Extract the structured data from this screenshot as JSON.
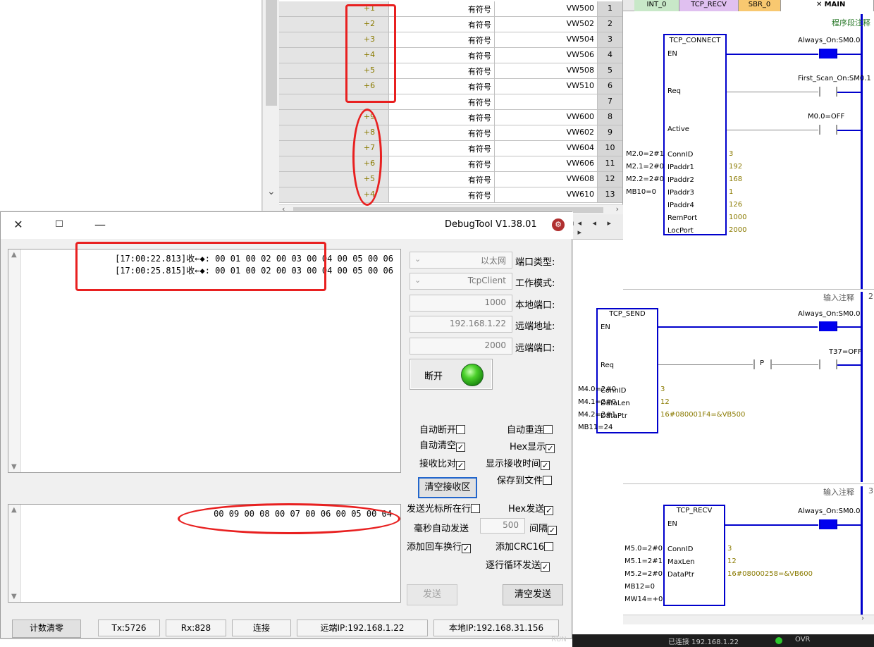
{
  "status_table": {
    "rows": [
      {
        "num": "1",
        "addr": "VW500",
        "fmt": "有符号",
        "value": "+1"
      },
      {
        "num": "2",
        "addr": "VW502",
        "fmt": "有符号",
        "value": "+2"
      },
      {
        "num": "3",
        "addr": "VW504",
        "fmt": "有符号",
        "value": "+3"
      },
      {
        "num": "4",
        "addr": "VW506",
        "fmt": "有符号",
        "value": "+4"
      },
      {
        "num": "5",
        "addr": "VW508",
        "fmt": "有符号",
        "value": "+5"
      },
      {
        "num": "6",
        "addr": "VW510",
        "fmt": "有符号",
        "value": "+6"
      },
      {
        "num": "7",
        "addr": "",
        "fmt": "有符号",
        "value": ""
      },
      {
        "num": "8",
        "addr": "VW600",
        "fmt": "有符号",
        "value": "+9"
      },
      {
        "num": "9",
        "addr": "VW602",
        "fmt": "有符号",
        "value": "+8"
      },
      {
        "num": "10",
        "addr": "VW604",
        "fmt": "有符号",
        "value": "+7"
      },
      {
        "num": "11",
        "addr": "VW606",
        "fmt": "有符号",
        "value": "+6"
      },
      {
        "num": "12",
        "addr": "VW608",
        "fmt": "有符号",
        "value": "+5"
      },
      {
        "num": "13",
        "addr": "VW610",
        "fmt": "有符号",
        "value": "+4"
      }
    ]
  },
  "ladder": {
    "tabs": [
      "MAIN",
      "SBR_0",
      "TCP_RECV",
      "INT_0"
    ],
    "network1": {
      "comment": "程序段注释",
      "block": "TCP_CONNECT",
      "pins": [
        "EN",
        "Req",
        "Active",
        "ConnID",
        "IPaddr1",
        "IPaddr2",
        "IPaddr3",
        "IPaddr4",
        "RemPort",
        "LocPort"
      ],
      "contacts": [
        "Always_On:SM0.0",
        "First_Scan_On:SM0.1",
        "M0.0=OFF"
      ],
      "outputs": [
        "M2.0=2#1",
        "M2.1=2#0",
        "M2.2=2#0",
        "MB10=0"
      ],
      "inputs": [
        "3",
        "192",
        "168",
        "1",
        "126",
        "1000",
        "2000"
      ]
    },
    "network2": {
      "num": "2",
      "comment": "输入注释",
      "block": "TCP_SEND",
      "pins": [
        "EN",
        "Req",
        "ConnID",
        "DataLen",
        "DataPtr"
      ],
      "contacts": [
        "Always_On:SM0.0",
        "T37=OFF"
      ],
      "pulse": "P",
      "outputs": [
        "M4.0=2#0",
        "M4.1=2#0",
        "M4.2=2#1",
        "MB11=24"
      ],
      "inputs": [
        "3",
        "12",
        "16#080001F4=&VB500"
      ]
    },
    "network3": {
      "num": "3",
      "comment": "输入注释",
      "block": "TCP_RECV",
      "pins": [
        "EN",
        "ConnID",
        "MaxLen",
        "DataPtr"
      ],
      "contacts": [
        "Always_On:SM0.0"
      ],
      "outputs": [
        "M5.0=2#0",
        "M5.1=2#1",
        "M5.2=2#0",
        "MB12=0",
        "MW14=+0"
      ],
      "inputs": [
        "3",
        "12",
        "16#08000258=&VB600"
      ]
    }
  },
  "debug": {
    "title": "DebugTool V1.38.01",
    "recv_lines": [
      "[17:00:22.813]收←◆:  00 01 00 02 00 03 00 04 00 05 00 06",
      "[17:00:25.815]收←◆:  00 01 00 02 00 03 00 04 00 05 00 06"
    ],
    "send_text": "00 09 00 08 00 07 00 06 00 05 00 04",
    "port_type_label": "端口类型:",
    "port_type_value": "以太网",
    "mode_label": "工作模式:",
    "mode_value": "TcpClient",
    "local_port_label": "本地端口:",
    "local_port_value": "1000",
    "remote_addr_label": "远端地址:",
    "remote_addr_value": "192.168.1.22",
    "remote_port_label": "远端端口:",
    "remote_port_value": "2000",
    "disconnect_label": "断开",
    "cb_auto_reconnect": "自动重连",
    "cb_auto_disconnect": "自动断开",
    "cb_hex_display": "Hex显示",
    "cb_auto_clear": "自动清空",
    "cb_show_time": "显示接收时间",
    "cb_recv_compare": "接收比对",
    "cb_save_file": "保存到文件",
    "btn_clear_recv": "清空接收区",
    "cb_hex_send": "Hex发送",
    "cb_send_cursor_line": "发送光标所在行",
    "cb_interval": "间隔",
    "interval_value": "500",
    "interval_unit": "毫秒自动发送",
    "cb_add_crc": "添加CRC16",
    "cb_add_newline": "添加回车换行",
    "cb_loop_send": "逐行循环发送",
    "btn_clear_send": "清空发送",
    "btn_send": "发送",
    "status": {
      "local_ip": "本地IP:192.168.31.156",
      "remote_ip": "远端IP:192.168.1.22",
      "conn": "连接",
      "rx": "Rx:828",
      "tx": "Tx:5726",
      "reset": "计数清零"
    }
  },
  "host_status": {
    "ovr": "OVR",
    "connected": "已连接 192.168.1.22",
    "run": "RUN"
  },
  "colors": {
    "accent_red": "#e82020",
    "ladder_blue": "#0000cc",
    "value_olive": "#8a7a00",
    "led_green": "#2ab51a"
  }
}
